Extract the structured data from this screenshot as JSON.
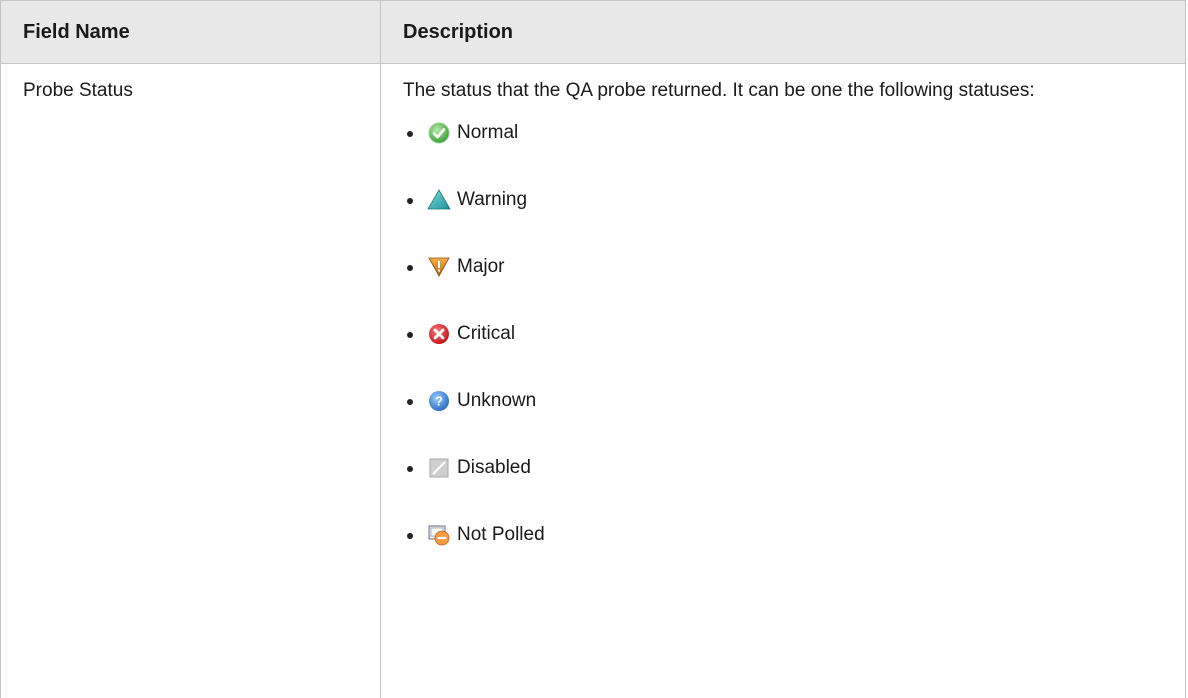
{
  "table": {
    "headers": [
      "Field Name",
      "Description"
    ],
    "row": {
      "field_name": "Probe Status",
      "description": "The status that the QA probe returned. It can be one the following statuses:",
      "statuses": [
        {
          "label": "Normal",
          "icon": "normal-status-icon",
          "color": "#5cb85c"
        },
        {
          "label": "Warning",
          "icon": "warning-status-icon",
          "color": "#3fb5b5"
        },
        {
          "label": "Major",
          "icon": "major-status-icon",
          "color": "#e08a1e"
        },
        {
          "label": "Critical",
          "icon": "critical-status-icon",
          "color": "#e0262a"
        },
        {
          "label": "Unknown",
          "icon": "unknown-status-icon",
          "color": "#3a8ee6"
        },
        {
          "label": "Disabled",
          "icon": "disabled-status-icon",
          "color": "#b8b8b8"
        },
        {
          "label": "Not Polled",
          "icon": "not-polled-status-icon",
          "color": "#f08a3a"
        }
      ]
    }
  }
}
